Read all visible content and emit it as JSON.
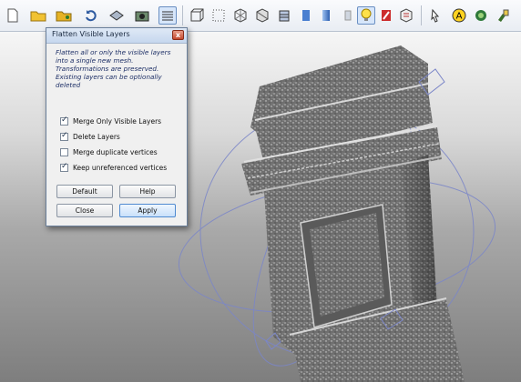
{
  "toolbar": {
    "buttons": [
      {
        "icon": "new-file-icon",
        "active": false
      },
      {
        "icon": "open-folder-icon",
        "active": false
      },
      {
        "icon": "open-project-icon",
        "active": false
      },
      {
        "icon": "reload-icon",
        "active": false
      },
      {
        "icon": "import-mesh-icon",
        "active": false
      },
      {
        "icon": "snapshot-icon",
        "active": false
      },
      {
        "icon": "layers-icon",
        "active": true
      },
      {
        "icon": "bounding-box-icon",
        "active": false
      },
      {
        "icon": "points-icon",
        "active": false
      },
      {
        "icon": "wireframe-icon",
        "active": false
      },
      {
        "icon": "hidden-lines-icon",
        "active": false
      },
      {
        "icon": "flat-lines-icon",
        "active": false
      },
      {
        "icon": "flat-icon",
        "active": false
      },
      {
        "icon": "smooth-icon",
        "active": false
      },
      {
        "icon": "texture-icon",
        "active": false
      },
      {
        "icon": "lighting-icon",
        "active": true
      },
      {
        "icon": "double-side-lighting-icon",
        "active": false
      },
      {
        "icon": "backface-culling-icon",
        "active": false
      },
      {
        "icon": "select-faces-icon",
        "active": false
      },
      {
        "icon": "annotation-icon",
        "active": false
      },
      {
        "icon": "color-icon",
        "active": false
      },
      {
        "icon": "paint-icon",
        "active": false
      }
    ]
  },
  "dialog": {
    "title": "Flatten Visible Layers",
    "close_glyph": "x",
    "description_lines": [
      "Flatten all or only the visible layers",
      "into a single new mesh.",
      "Transformations are preserved.",
      "Existing layers can be optionally",
      "deleted"
    ],
    "options": [
      {
        "label": "Merge Only Visible Layers",
        "checked": true
      },
      {
        "label": "Delete Layers",
        "checked": true
      },
      {
        "label": "Merge duplicate vertices",
        "checked": false
      },
      {
        "label": "Keep unreferenced vertices",
        "checked": true
      }
    ],
    "buttons": {
      "default": "Default",
      "help": "Help",
      "close": "Close",
      "apply": "Apply"
    }
  }
}
